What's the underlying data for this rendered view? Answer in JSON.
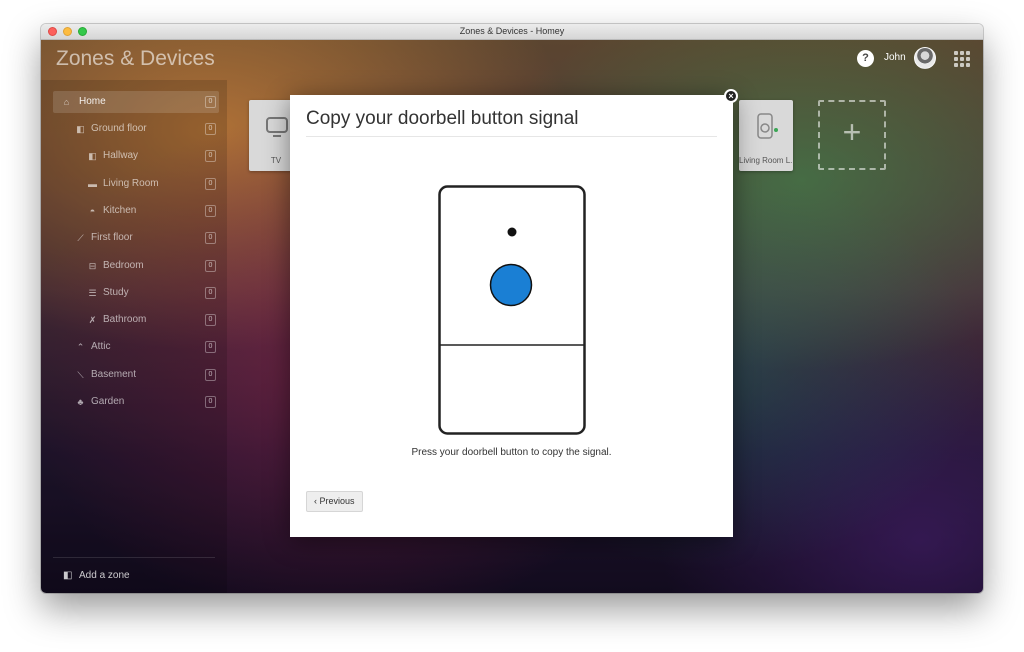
{
  "window": {
    "title": "Zones & Devices - Homey"
  },
  "header": {
    "app_title": "Zones & Devices",
    "help_label": "?",
    "user_name": "John"
  },
  "sidebar": {
    "zones": [
      {
        "label": "Home",
        "count": "0",
        "icon": "house-icon",
        "active": true
      },
      {
        "label": "Ground floor",
        "count": "0",
        "icon": "floor-icon"
      },
      {
        "label": "Hallway",
        "count": "0",
        "icon": "door-icon"
      },
      {
        "label": "Living Room",
        "count": "0",
        "icon": "sofa-icon"
      },
      {
        "label": "Kitchen",
        "count": "0",
        "icon": "pot-icon"
      },
      {
        "label": "First floor",
        "count": "0",
        "icon": "stairs-icon"
      },
      {
        "label": "Bedroom",
        "count": "0",
        "icon": "bed-icon"
      },
      {
        "label": "Study",
        "count": "0",
        "icon": "desk-icon"
      },
      {
        "label": "Bathroom",
        "count": "0",
        "icon": "shower-icon"
      },
      {
        "label": "Attic",
        "count": "0",
        "icon": "roof-icon"
      },
      {
        "label": "Basement",
        "count": "0",
        "icon": "stairs-down-icon"
      },
      {
        "label": "Garden",
        "count": "0",
        "icon": "plant-icon"
      }
    ],
    "add_zone_label": "Add a zone"
  },
  "devices": [
    {
      "label": "TV",
      "icon": "tv-icon"
    },
    {
      "label": "Living Room L...",
      "icon": "light-switch-icon"
    }
  ],
  "add_device_label": "+",
  "modal": {
    "title": "Copy your doorbell button signal",
    "instruction": "Press your doorbell button to copy the signal.",
    "previous_label": "‹ Previous",
    "close_label": "×",
    "button_color": "#1a7fd4"
  }
}
